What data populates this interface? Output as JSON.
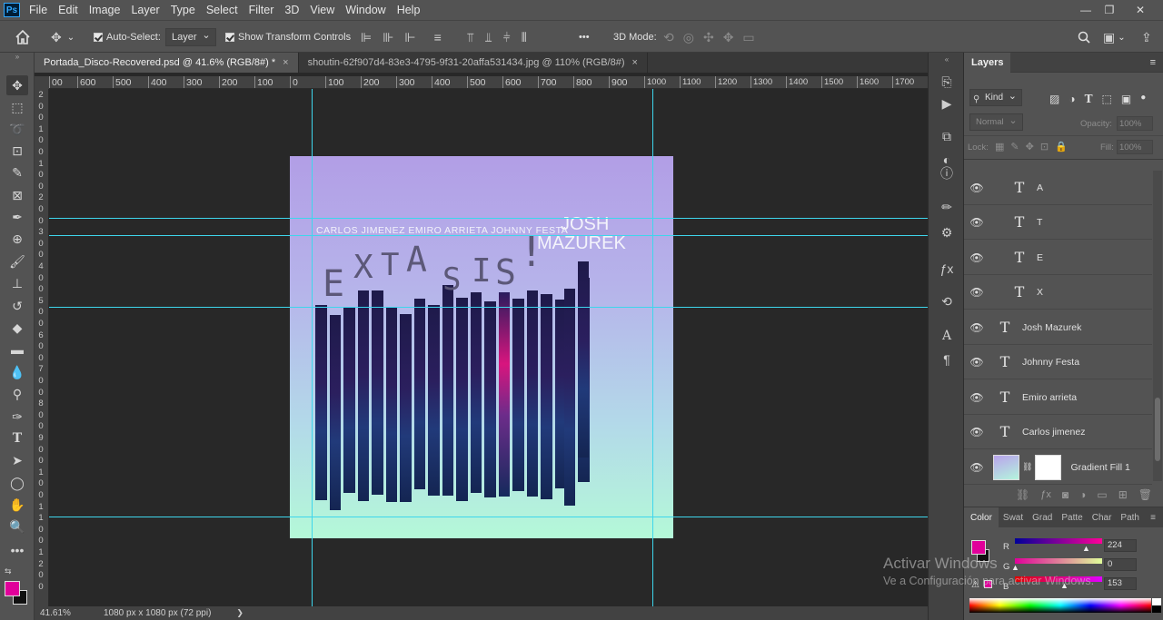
{
  "menu": [
    "File",
    "Edit",
    "Image",
    "Layer",
    "Type",
    "Select",
    "Filter",
    "3D",
    "View",
    "Window",
    "Help"
  ],
  "window_controls": {
    "minimize": "—",
    "restore": "❐",
    "close": "✕"
  },
  "options": {
    "auto_select_label": "Auto-Select:",
    "auto_select_value": "Layer",
    "show_transform_label": "Show Transform Controls",
    "more": "•••",
    "mode_3d": "3D Mode:"
  },
  "tabs": [
    {
      "label": "Portada_Disco-Recovered.psd @ 41.6% (RGB/8#) *",
      "close": "×"
    },
    {
      "label": "shoutin-62f907d4-83e3-4795-9f31-20affa531434.jpg @ 110% (RGB/8#)",
      "close": "×"
    }
  ],
  "ruler_h": [
    "00",
    "600",
    "500",
    "400",
    "300",
    "200",
    "100",
    "0",
    "100",
    "200",
    "300",
    "400",
    "500",
    "600",
    "700",
    "800",
    "900",
    "1000",
    "1100",
    "1200",
    "1300",
    "1400",
    "1500",
    "1600",
    "1700"
  ],
  "ruler_v": [
    "2",
    "0",
    "0",
    "1",
    "0",
    "0",
    "1",
    "0",
    "0",
    "2",
    "0",
    "0",
    "3",
    "0",
    "0",
    "4",
    "0",
    "0",
    "5",
    "0",
    "0",
    "6",
    "0",
    "0",
    "7",
    "0",
    "0",
    "8",
    "0",
    "0",
    "9",
    "0",
    "0",
    "1",
    "0",
    "0",
    "1",
    "1",
    "0",
    "0",
    "1",
    "2",
    "0",
    "0"
  ],
  "artwork": {
    "names": "CARLOS  JIMENEZ  EMIRO  ARRIETA  JOHNNY  FESTA",
    "artist_first": "JOSH",
    "artist_last": "MAZUREK",
    "letters": [
      "E",
      "X",
      "T",
      "A",
      "S",
      "I",
      "S",
      "!"
    ]
  },
  "status": {
    "zoom": "41.61%",
    "doc": "1080 px x 1080 px (72 ppi)",
    "arrow": "❯"
  },
  "layers_panel": {
    "title": "Layers",
    "kind": "Kind",
    "blend": "Normal",
    "opacity_label": "Opacity:",
    "opacity_value": "100%",
    "lock_label": "Lock:",
    "fill_label": "Fill:",
    "fill_value": "100%",
    "layers": [
      {
        "type": "T",
        "name": "A",
        "indent": true
      },
      {
        "type": "T",
        "name": "T",
        "indent": true
      },
      {
        "type": "T",
        "name": "E",
        "indent": true
      },
      {
        "type": "T",
        "name": "X",
        "indent": true
      },
      {
        "type": "T",
        "name": "Josh Mazurek",
        "indent": false
      },
      {
        "type": "T",
        "name": "Johnny Festa",
        "indent": false
      },
      {
        "type": "T",
        "name": "Emiro arrieta",
        "indent": false
      },
      {
        "type": "T",
        "name": "Carlos jimenez",
        "indent": false
      },
      {
        "type": "fill",
        "name": "Gradient Fill 1",
        "indent": false
      }
    ]
  },
  "color_panel": {
    "tabs": [
      "Color",
      "Swat",
      "Grad",
      "Patte",
      "Char",
      "Path"
    ],
    "foreground": "#e0009a",
    "r_label": "R",
    "g_label": "G",
    "b_label": "B",
    "r": "224",
    "g": "0",
    "b": "153"
  },
  "watermark": {
    "line1": "Activar Windows",
    "line2": "Ve a Configuración para activar Windows."
  }
}
